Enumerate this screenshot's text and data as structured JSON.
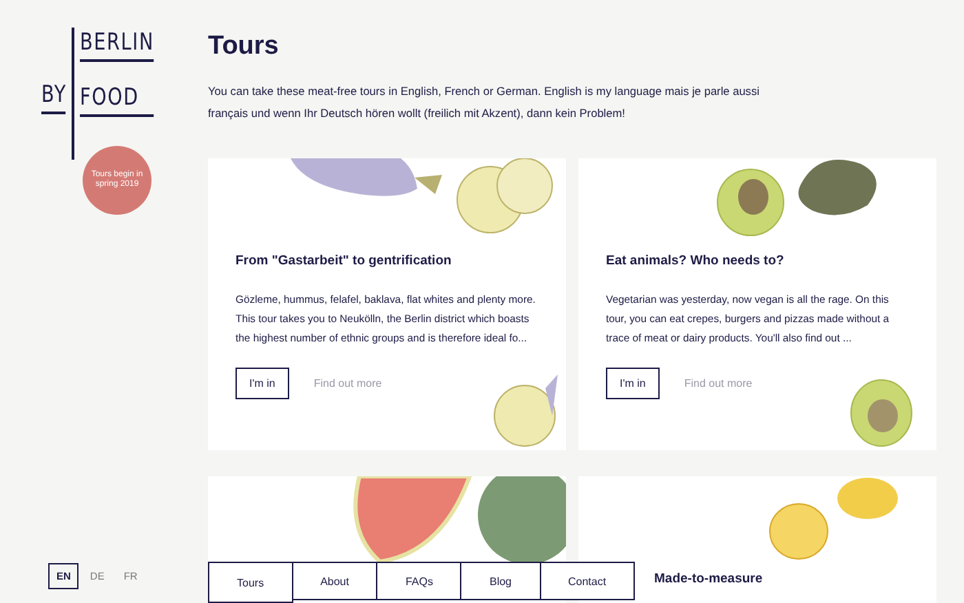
{
  "logo": {
    "line_1": "BY",
    "line_2": "BERLIN",
    "line_3": "FOOD"
  },
  "badge": {
    "text": "Tours begin in spring 2019"
  },
  "languages": [
    {
      "label": "EN",
      "selected": true
    },
    {
      "label": "DE",
      "selected": false
    },
    {
      "label": "FR",
      "selected": false
    }
  ],
  "page": {
    "title": "Tours",
    "intro": "You can take these meat-free tours in English, French or German. English is my language mais je parle aussi français und wenn Ihr Deutsch hören wollt (freilich mit Akzent), dann kein Problem!"
  },
  "tours": [
    {
      "kind": "eggplant",
      "title": "From \"Gastarbeit\" to gentrification",
      "description": "Gözleme, hummus, felafel, baklava, flat whites and plenty more. This tour takes you to Neukölln, the Berlin district which boasts the highest number of ethnic groups and is therefore ideal fo...",
      "primary_button": "I'm in",
      "secondary_link": "Find out more"
    },
    {
      "kind": "avocado",
      "title": "Eat animals? Who needs to?",
      "description": "Vegetarian was yesterday, now vegan is all the rage. On this tour, you can eat crepes, burgers and pizzas made without a trace of meat or dairy products. You'll also find out ...",
      "primary_button": "I'm in",
      "secondary_link": "Find out more"
    },
    {
      "kind": "watermelon"
    },
    {
      "kind": "lemon",
      "title": "Made-to-measure"
    }
  ],
  "nav": [
    {
      "label": "Tours",
      "selected": true
    },
    {
      "label": "About",
      "selected": false
    },
    {
      "label": "FAQs",
      "selected": false
    },
    {
      "label": "Blog",
      "selected": false
    },
    {
      "label": "Contact",
      "selected": false
    }
  ]
}
